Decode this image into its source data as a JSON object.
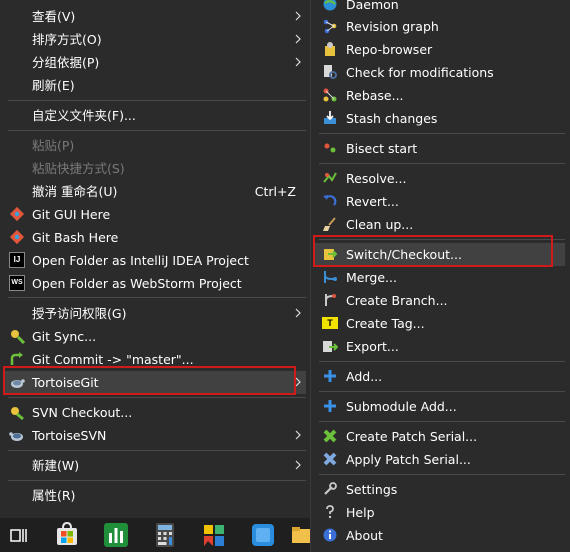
{
  "left_menu": {
    "view": "查看(V)",
    "sort": "排序方式(O)",
    "group": "分组依据(P)",
    "refresh": "刷新(E)",
    "customize": "自定义文件夹(F)...",
    "paste": "粘贴(P)",
    "paste_shortcut": "粘贴快捷方式(S)",
    "undo": "撤消 重命名(U)",
    "undo_shortcut": "Ctrl+Z",
    "git_gui": "Git GUI Here",
    "git_bash": "Git Bash Here",
    "intellij": "Open Folder as IntelliJ IDEA Project",
    "webstorm": "Open Folder as WebStorm Project",
    "grant_access": "授予访问权限(G)",
    "git_sync": "Git Sync...",
    "git_commit": "Git Commit -> \"master\"...",
    "tortoisegit": "TortoiseGit",
    "svn_checkout": "SVN Checkout...",
    "tortoisesvn": "TortoiseSVN",
    "new": "新建(W)",
    "properties": "属性(R)"
  },
  "right_menu": {
    "daemon": "Daemon",
    "revision_graph": "Revision graph",
    "repo_browser": "Repo-browser",
    "check_mods": "Check for modifications",
    "rebase": "Rebase...",
    "stash": "Stash changes",
    "bisect": "Bisect start",
    "resolve": "Resolve...",
    "revert": "Revert...",
    "cleanup": "Clean up...",
    "switch": "Switch/Checkout...",
    "merge": "Merge...",
    "branch": "Create Branch...",
    "tag": "Create Tag...",
    "export": "Export...",
    "add": "Add...",
    "submodule_add": "Submodule Add...",
    "create_patch": "Create Patch Serial...",
    "apply_patch": "Apply Patch Serial...",
    "settings": "Settings",
    "help": "Help",
    "about": "About"
  },
  "icons": {
    "intellij_badge": "IJ",
    "webstorm_badge": "WS",
    "tag_badge": "T"
  },
  "colors": {
    "menu_bg": "#2b2b2b",
    "highlight": "#414141",
    "separator": "#4a4a4a",
    "red_annotation": "#d11a1a",
    "disabled_text": "#7a7a7a"
  }
}
